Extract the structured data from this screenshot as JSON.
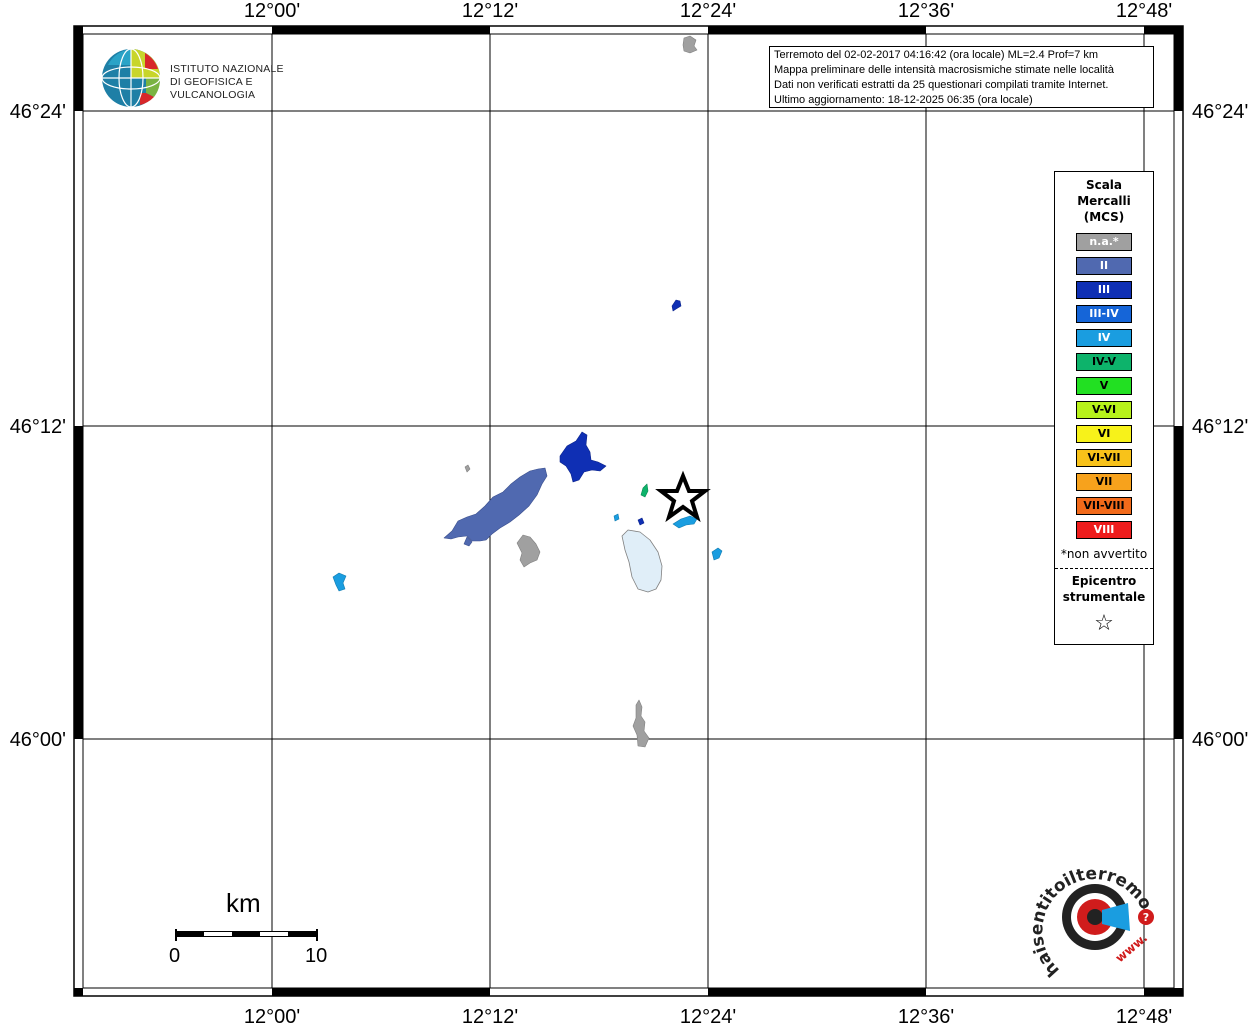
{
  "map": {
    "lon_labels": [
      "12°00'",
      "12°12'",
      "12°24'",
      "12°36'",
      "12°48'"
    ],
    "lat_labels": [
      "46°24'",
      "46°12'",
      "46°00'"
    ]
  },
  "info_box": {
    "lines": [
      "Terremoto del 02-02-2017 04:16:42 (ora locale) ML=2.4 Prof=7 km",
      "Mappa preliminare delle intensità macrosismiche stimate nelle località",
      "Dati non verificati estratti da 25 questionari compilati tramite Internet.",
      "Ultimo aggiornamento: 18-12-2025 06:35 (ora locale)"
    ]
  },
  "ingv_logo": {
    "line1": "ISTITUTO NAZIONALE",
    "line2": "DI GEOFISICA E VULCANOLOGIA"
  },
  "legend": {
    "title_line1": "Scala",
    "title_line2": "Mercalli",
    "title_line3": "(MCS)",
    "items": [
      {
        "label": "n.a.*",
        "color": "#a0a0a0",
        "text_color": "#ffffff"
      },
      {
        "label": "II",
        "color": "#5069b0",
        "text_color": "#ffffff"
      },
      {
        "label": "III",
        "color": "#0f2fb4",
        "text_color": "#ffffff"
      },
      {
        "label": "III-IV",
        "color": "#1565d8",
        "text_color": "#ffffff"
      },
      {
        "label": "IV",
        "color": "#1a9de0",
        "text_color": "#ffffff"
      },
      {
        "label": "IV-V",
        "color": "#0db36b",
        "text_color": "#000000"
      },
      {
        "label": "V",
        "color": "#22e022",
        "text_color": "#000000"
      },
      {
        "label": "V-VI",
        "color": "#b7f21b",
        "text_color": "#000000"
      },
      {
        "label": "VI",
        "color": "#f7f21a",
        "text_color": "#000000"
      },
      {
        "label": "VI-VII",
        "color": "#f8c21a",
        "text_color": "#000000"
      },
      {
        "label": "VII",
        "color": "#f7a21c",
        "text_color": "#000000"
      },
      {
        "label": "VII-VIII",
        "color": "#f26a1a",
        "text_color": "#000000"
      },
      {
        "label": "VIII",
        "color": "#ee1c1c",
        "text_color": "#ffffff"
      }
    ],
    "note": "*non avvertito",
    "epicenter_line1": "Epicentro",
    "epicenter_line2": "strumentale",
    "epicenter_symbol": "☆"
  },
  "scalebar": {
    "unit": "km",
    "zero": "0",
    "ten": "10"
  },
  "hsit_logo": {
    "text": "haisentitoilterremoto.it",
    "prefix": "www."
  }
}
